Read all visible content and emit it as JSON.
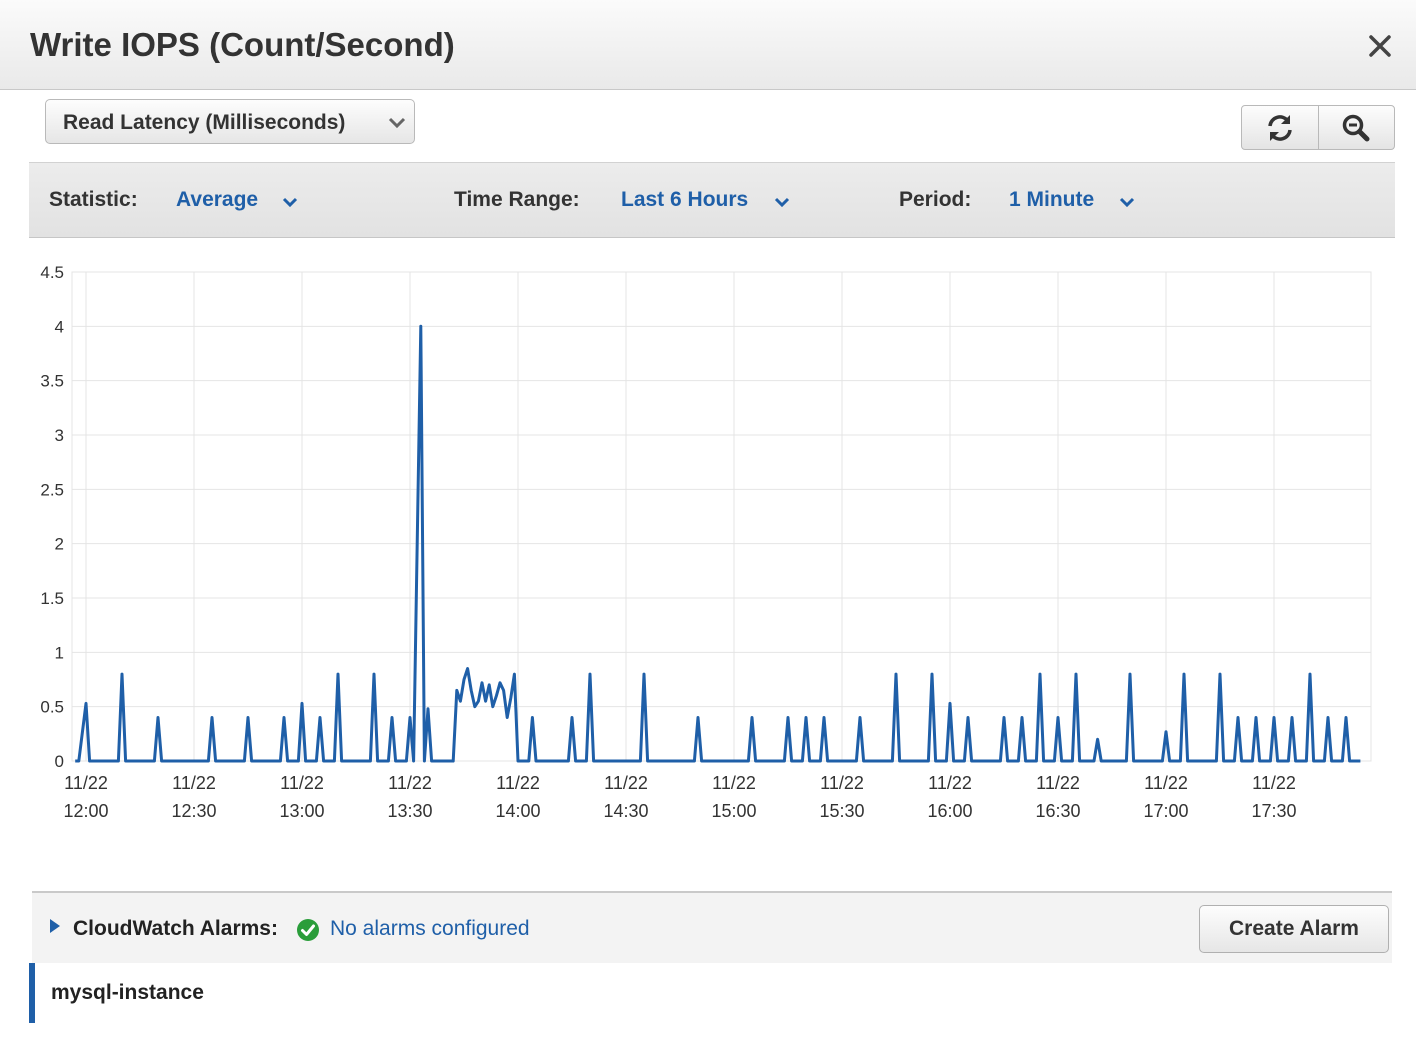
{
  "dialog": {
    "title": "Write IOPS (Count/Second)",
    "close_icon": "close-icon"
  },
  "metric_select": {
    "selected": "Read Latency (Milliseconds)"
  },
  "toolbar": {
    "refresh_icon": "refresh-icon",
    "zoom_icon": "zoom-icon",
    "statistic_label": "Statistic:",
    "statistic_value": "Average",
    "time_range_label": "Time Range:",
    "time_range_value": "Last 6 Hours",
    "period_label": "Period:",
    "period_value": "1 Minute"
  },
  "chart_data": {
    "type": "line",
    "title": "",
    "xlabel": "",
    "ylabel": "",
    "ylim": [
      0,
      4.5
    ],
    "y_ticks": [
      "0",
      "0.5",
      "1",
      "1.5",
      "2",
      "2.5",
      "3",
      "3.5",
      "4",
      "4.5"
    ],
    "x_tick_labels": [
      [
        "11/22",
        "12:00"
      ],
      [
        "11/22",
        "12:30"
      ],
      [
        "11/22",
        "13:00"
      ],
      [
        "11/22",
        "13:30"
      ],
      [
        "11/22",
        "14:00"
      ],
      [
        "11/22",
        "14:30"
      ],
      [
        "11/22",
        "15:00"
      ],
      [
        "11/22",
        "15:30"
      ],
      [
        "11/22",
        "16:00"
      ],
      [
        "11/22",
        "16:30"
      ],
      [
        "11/22",
        "17:00"
      ],
      [
        "11/22",
        "17:30"
      ]
    ],
    "grid": true,
    "color": "#1f5fa8",
    "series": [
      {
        "points": [
          [
            "11:57",
            0
          ],
          [
            "11:58",
            0
          ],
          [
            "12:00",
            0.53
          ],
          [
            "12:01",
            0
          ],
          [
            "12:09",
            0
          ],
          [
            "12:10",
            0.8
          ],
          [
            "12:11",
            0
          ],
          [
            "12:19",
            0
          ],
          [
            "12:20",
            0.4
          ],
          [
            "12:21",
            0
          ],
          [
            "12:34",
            0
          ],
          [
            "12:35",
            0.4
          ],
          [
            "12:36",
            0
          ],
          [
            "12:44",
            0
          ],
          [
            "12:45",
            0.4
          ],
          [
            "12:46",
            0
          ],
          [
            "12:54",
            0
          ],
          [
            "12:55",
            0.4
          ],
          [
            "12:56",
            0
          ],
          [
            "12:59",
            0
          ],
          [
            "13:00",
            0.53
          ],
          [
            "13:01",
            0
          ],
          [
            "13:04",
            0
          ],
          [
            "13:05",
            0.4
          ],
          [
            "13:06",
            0
          ],
          [
            "13:09",
            0
          ],
          [
            "13:10",
            0.8
          ],
          [
            "13:11",
            0
          ],
          [
            "13:19",
            0
          ],
          [
            "13:20",
            0.8
          ],
          [
            "13:21",
            0
          ],
          [
            "13:24",
            0
          ],
          [
            "13:25",
            0.4
          ],
          [
            "13:26",
            0
          ],
          [
            "13:29",
            0
          ],
          [
            "13:30",
            0.4
          ],
          [
            "13:31",
            0
          ],
          [
            "13:33",
            4.0
          ],
          [
            "13:34",
            0
          ],
          [
            "13:35",
            0.48
          ],
          [
            "13:36",
            0
          ],
          [
            "13:42",
            0
          ],
          [
            "13:43",
            0.65
          ],
          [
            "13:44",
            0.55
          ],
          [
            "13:45",
            0.75
          ],
          [
            "13:46",
            0.85
          ],
          [
            "13:47",
            0.65
          ],
          [
            "13:48",
            0.5
          ],
          [
            "13:49",
            0.55
          ],
          [
            "13:50",
            0.72
          ],
          [
            "13:51",
            0.55
          ],
          [
            "13:52",
            0.7
          ],
          [
            "13:53",
            0.5
          ],
          [
            "13:54",
            0.6
          ],
          [
            "13:55",
            0.72
          ],
          [
            "13:56",
            0.65
          ],
          [
            "13:57",
            0.4
          ],
          [
            "13:58",
            0.58
          ],
          [
            "13:59",
            0.8
          ],
          [
            "14:00",
            0
          ],
          [
            "14:03",
            0
          ],
          [
            "14:04",
            0.4
          ],
          [
            "14:05",
            0
          ],
          [
            "14:14",
            0
          ],
          [
            "14:15",
            0.4
          ],
          [
            "14:16",
            0
          ],
          [
            "14:19",
            0
          ],
          [
            "14:20",
            0.8
          ],
          [
            "14:21",
            0
          ],
          [
            "14:34",
            0
          ],
          [
            "14:35",
            0.8
          ],
          [
            "14:36",
            0
          ],
          [
            "14:49",
            0
          ],
          [
            "14:50",
            0.4
          ],
          [
            "14:51",
            0
          ],
          [
            "15:04",
            0
          ],
          [
            "15:05",
            0.4
          ],
          [
            "15:06",
            0
          ],
          [
            "15:14",
            0
          ],
          [
            "15:15",
            0.4
          ],
          [
            "15:16",
            0
          ],
          [
            "15:19",
            0
          ],
          [
            "15:20",
            0.4
          ],
          [
            "15:21",
            0
          ],
          [
            "15:24",
            0
          ],
          [
            "15:25",
            0.4
          ],
          [
            "15:26",
            0
          ],
          [
            "15:34",
            0
          ],
          [
            "15:35",
            0.4
          ],
          [
            "15:36",
            0
          ],
          [
            "15:44",
            0
          ],
          [
            "15:45",
            0.8
          ],
          [
            "15:46",
            0
          ],
          [
            "15:54",
            0
          ],
          [
            "15:55",
            0.8
          ],
          [
            "15:56",
            0
          ],
          [
            "15:59",
            0
          ],
          [
            "16:00",
            0.53
          ],
          [
            "16:01",
            0
          ],
          [
            "16:04",
            0
          ],
          [
            "16:05",
            0.4
          ],
          [
            "16:06",
            0
          ],
          [
            "16:14",
            0
          ],
          [
            "16:15",
            0.4
          ],
          [
            "16:16",
            0
          ],
          [
            "16:19",
            0
          ],
          [
            "16:20",
            0.4
          ],
          [
            "16:21",
            0
          ],
          [
            "16:24",
            0
          ],
          [
            "16:25",
            0.8
          ],
          [
            "16:26",
            0
          ],
          [
            "16:29",
            0
          ],
          [
            "16:30",
            0.4
          ],
          [
            "16:31",
            0
          ],
          [
            "16:34",
            0
          ],
          [
            "16:35",
            0.8
          ],
          [
            "16:36",
            0
          ],
          [
            "16:40",
            0
          ],
          [
            "16:41",
            0.2
          ],
          [
            "16:42",
            0
          ],
          [
            "16:49",
            0
          ],
          [
            "16:50",
            0.8
          ],
          [
            "16:51",
            0
          ],
          [
            "16:59",
            0
          ],
          [
            "17:00",
            0.27
          ],
          [
            "17:01",
            0
          ],
          [
            "17:04",
            0
          ],
          [
            "17:05",
            0.8
          ],
          [
            "17:06",
            0
          ],
          [
            "17:14",
            0
          ],
          [
            "17:15",
            0.8
          ],
          [
            "17:16",
            0
          ],
          [
            "17:19",
            0
          ],
          [
            "17:20",
            0.4
          ],
          [
            "17:21",
            0
          ],
          [
            "17:24",
            0
          ],
          [
            "17:25",
            0.4
          ],
          [
            "17:26",
            0
          ],
          [
            "17:29",
            0
          ],
          [
            "17:30",
            0.4
          ],
          [
            "17:31",
            0
          ],
          [
            "17:34",
            0
          ],
          [
            "17:35",
            0.4
          ],
          [
            "17:36",
            0
          ],
          [
            "17:39",
            0
          ],
          [
            "17:40",
            0.8
          ],
          [
            "17:41",
            0
          ],
          [
            "17:44",
            0
          ],
          [
            "17:45",
            0.4
          ],
          [
            "17:46",
            0
          ],
          [
            "17:49",
            0
          ],
          [
            "17:50",
            0.4
          ],
          [
            "17:51",
            0
          ],
          [
            "17:54",
            0
          ]
        ]
      }
    ]
  },
  "alarms": {
    "expand_icon": "triangle-right-icon",
    "label": "CloudWatch Alarms:",
    "status_icon": "check-circle-icon",
    "status_color": "#2a9d3a",
    "status_text": "No alarms configured",
    "create_button": "Create Alarm"
  },
  "instance": {
    "name": "mysql-instance",
    "accent_color": "#1f5fa8"
  }
}
